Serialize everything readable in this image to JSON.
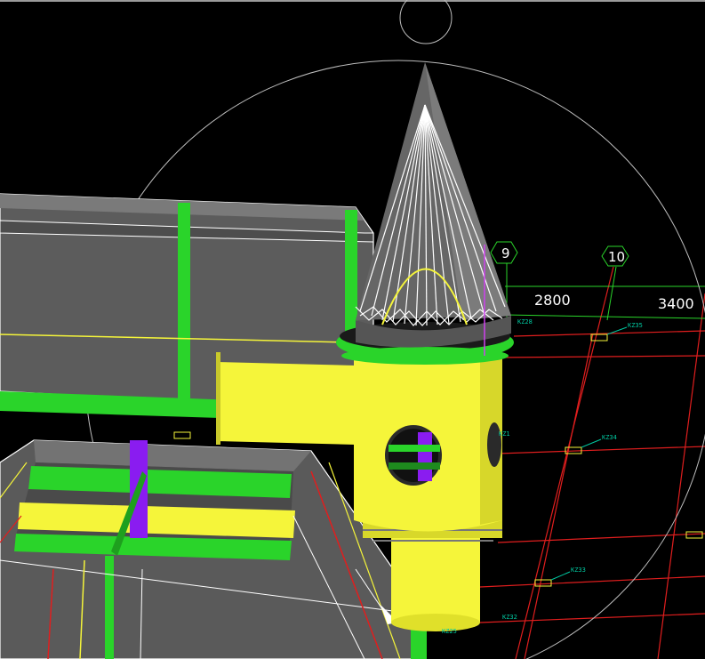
{
  "viewport": {
    "background": "#000000",
    "description_colors": {
      "wall_yellow": "#f5f53a",
      "beam_green": "#2ad42a",
      "slab_gray": "#5a5a5a",
      "gridline_red": "#e01e1e",
      "highlight_purple": "#8a1cf0",
      "tag_teal": "#00c8a0",
      "orbit_circle": "#bdbdbd"
    }
  },
  "grid_axes": [
    {
      "label": "9"
    },
    {
      "label": "10"
    }
  ],
  "dimensions": [
    {
      "value": "2800"
    },
    {
      "value": "3400"
    }
  ],
  "element_tags": [
    {
      "text": "KZ28"
    },
    {
      "text": "KZ35"
    },
    {
      "text": "KZ34"
    },
    {
      "text": "KZ33"
    },
    {
      "text": "KZ32"
    },
    {
      "text": "KZ25"
    },
    {
      "text": "KZ1"
    }
  ],
  "view_controls": {
    "orbit_circle": "orbit-rotation-circle",
    "pan_handle": "orbit-top-handle",
    "left_handle": "orbit-left-handle"
  }
}
